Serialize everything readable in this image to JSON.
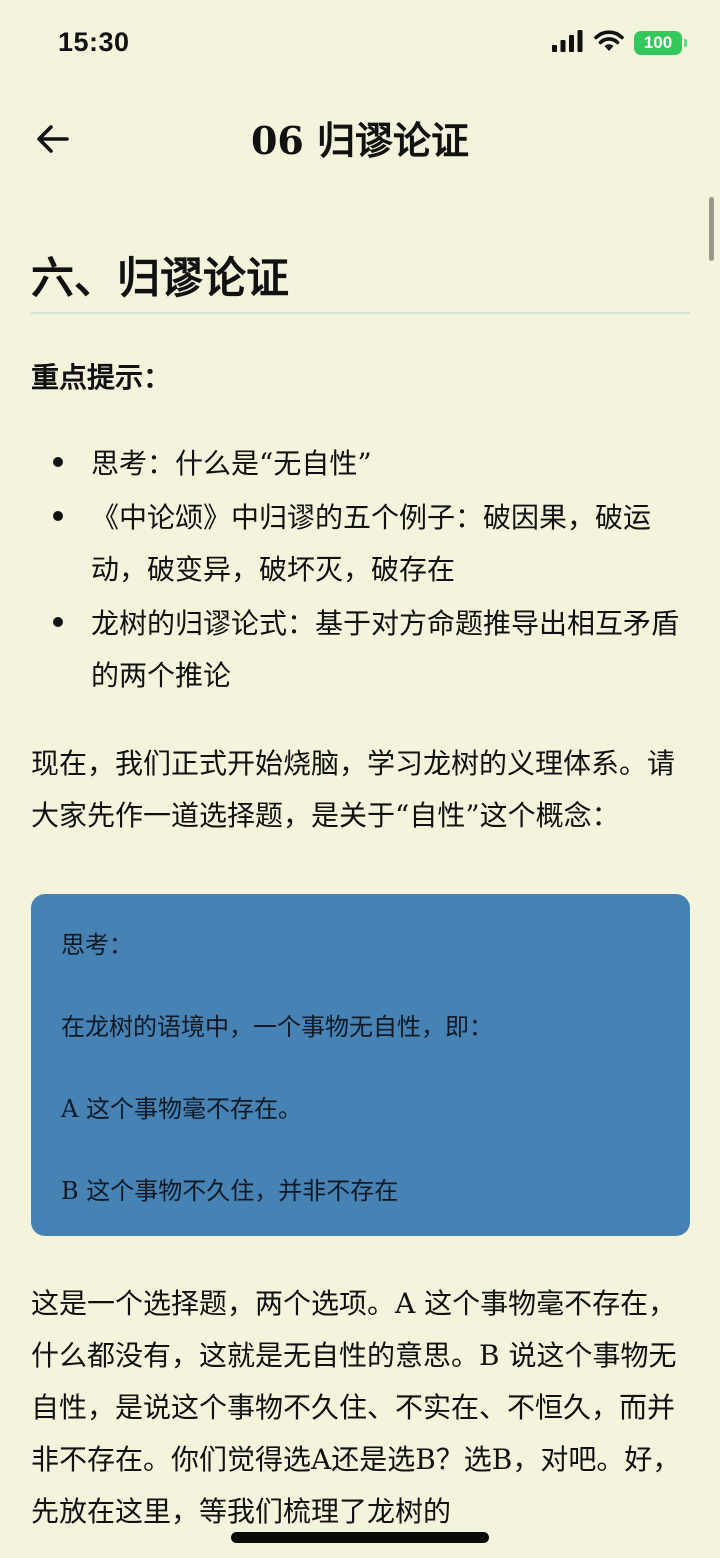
{
  "status_bar": {
    "time": "15:30",
    "battery": "100"
  },
  "nav": {
    "title": "06 归谬论证"
  },
  "article": {
    "heading": "六、归谬论证",
    "key_points_label": "重点提示：",
    "points": [
      "思考：什么是“无自性”",
      "《中论颂》中归谬的五个例子：破因果，破运动，破变异，破坏灭，破存在",
      "龙树的归谬论式：基于对方命题推导出相互矛盾的两个推论"
    ],
    "intro": "现在，我们正式开始烧脑，学习龙树的义理体系。请大家先作一道选择题，是关于“自性”这个概念：",
    "callout": {
      "label": "思考：",
      "question": "在龙树的语境中，一个事物无自性，即：",
      "option_a": "A 这个事物毫不存在。",
      "option_b": "B 这个事物不久住，并非不存在"
    },
    "body": "这是一个选择题，两个选项。A 这个事物毫不存在，什么都没有，这就是无自性的意思。B 说这个事物无自性，是说这个事物不久住、不实在、不恒久，而并非不存在。你们觉得选A还是选B？选B，对吧。好，先放在这里，等我们梳理了龙树的"
  },
  "colors": {
    "background": "#f4f4dc",
    "callout": "#4682b4",
    "battery": "#34c759"
  },
  "icons": {
    "back": "arrow-left-icon",
    "signal": "signal-icon",
    "wifi": "wifi-icon",
    "battery": "battery-icon"
  }
}
